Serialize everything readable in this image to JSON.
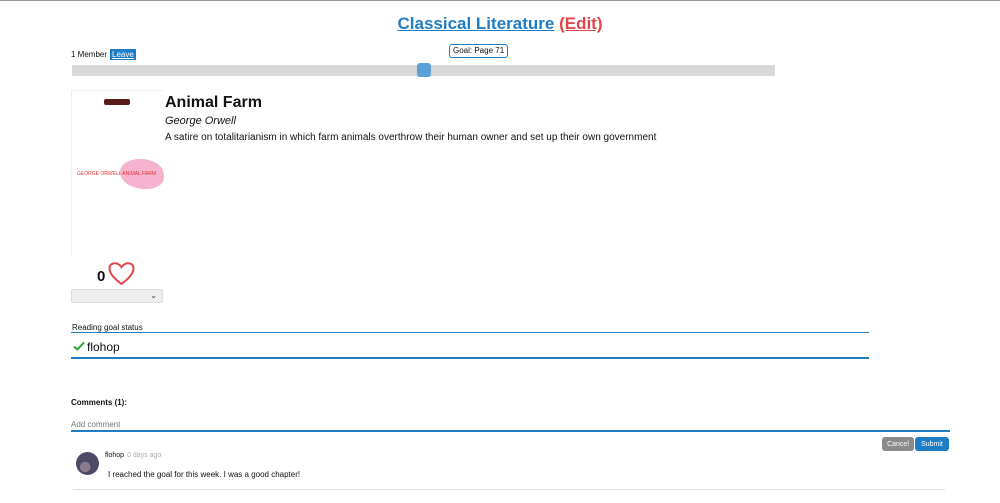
{
  "club": {
    "title": "Classical Literature",
    "edit_label": "(Edit)"
  },
  "membership": {
    "count_label": "1 Member",
    "leave_label": "Leave"
  },
  "goal": {
    "tooltip": "Goal: Page 71",
    "progress_fraction": 0.5
  },
  "book": {
    "title": "Animal Farm",
    "author": "George Orwell",
    "description": "A satire on totalitarianism in which farm animals overthrow their human owner and set up their own government",
    "cover_text": "GEORGE ORWELL ANIMAL FARM",
    "likes": "0",
    "status_selected": ""
  },
  "reading_goal": {
    "label": "Reading goal status",
    "users": [
      {
        "name": "flohop",
        "done": true
      }
    ]
  },
  "comments": {
    "heading": "Comments (1):",
    "placeholder": "Add comment",
    "cancel_label": "Cancel",
    "submit_label": "Submit",
    "items": [
      {
        "user": "flohop",
        "time": "0 days ago",
        "text": "I reached the goal for this week. I was a good chapter!"
      }
    ]
  },
  "colors": {
    "accent": "#1f7dc6",
    "edit": "#e0464b",
    "heart": "#e0464b",
    "check": "#2aa53a"
  },
  "icons": {
    "like": "heart-icon",
    "done": "check-icon",
    "dropdown": "chevron-down-icon"
  }
}
